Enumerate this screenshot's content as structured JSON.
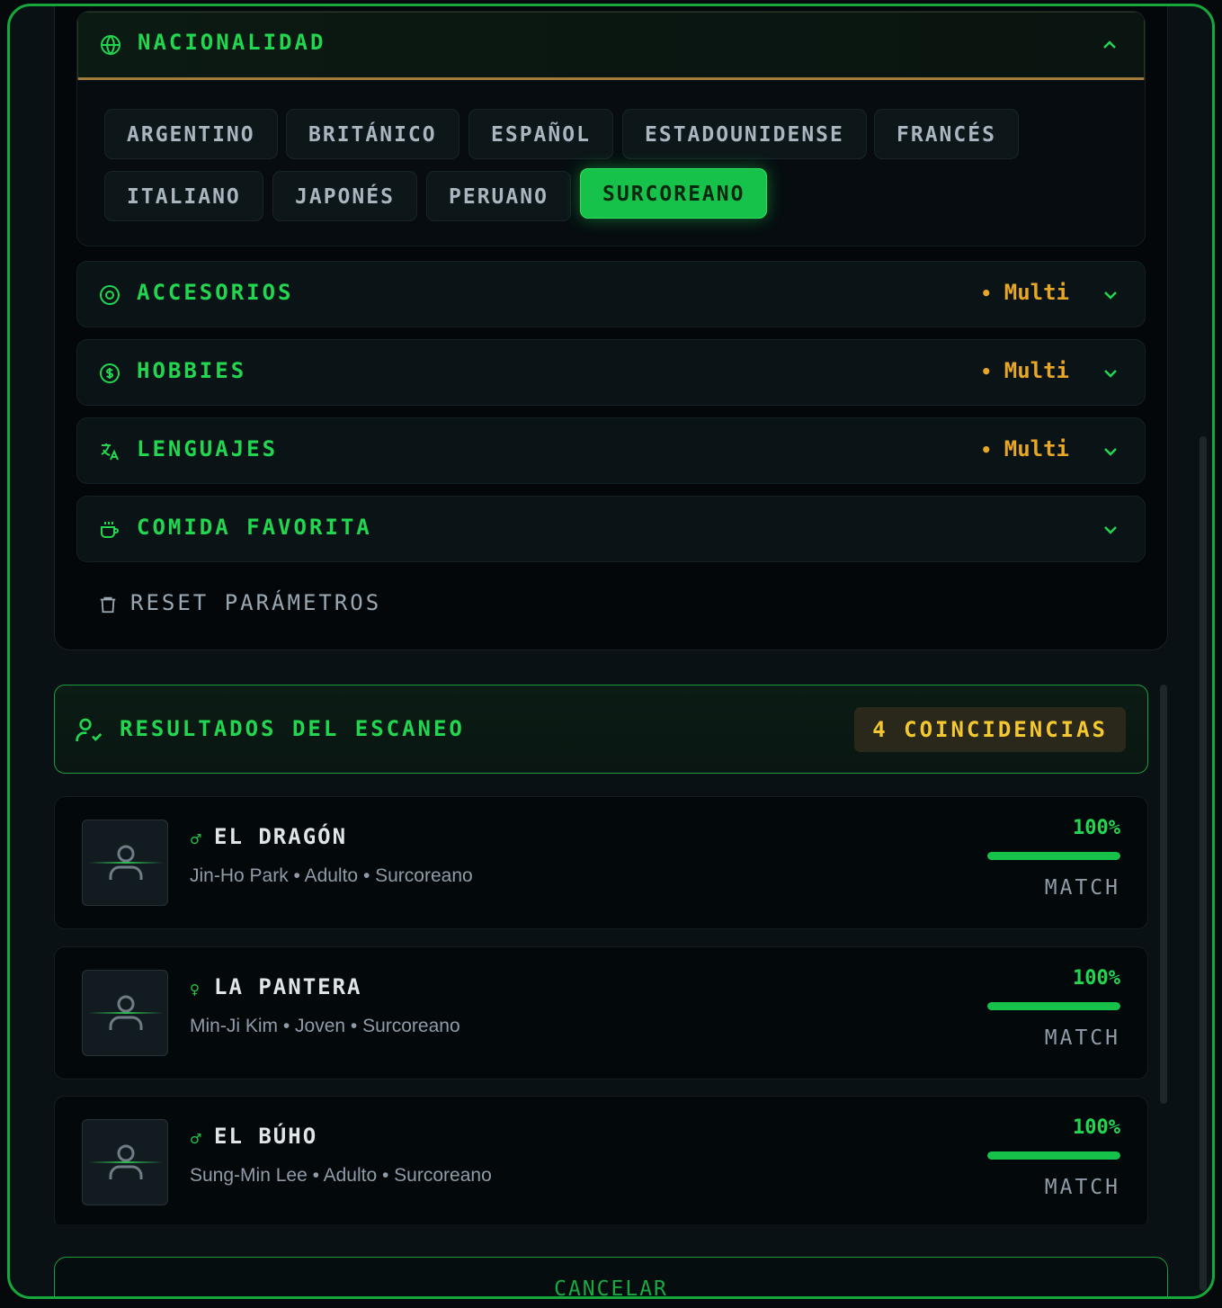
{
  "nationality": {
    "title": "NACIONALIDAD",
    "options": [
      "ARGENTINO",
      "BRITÁNICO",
      "ESPAÑOL",
      "ESTADOUNIDENSE",
      "FRANCÉS",
      "ITALIANO",
      "JAPONÉS",
      "PERUANO",
      "SURCOREANO"
    ],
    "selected": "SURCOREANO"
  },
  "sections": [
    {
      "title": "ACCESORIOS",
      "icon": "target-icon",
      "badge": "Multi"
    },
    {
      "title": "HOBBIES",
      "icon": "coin-icon",
      "badge": "Multi"
    },
    {
      "title": "LENGUAJES",
      "icon": "translate-icon",
      "badge": "Multi"
    },
    {
      "title": "COMIDA FAVORITA",
      "icon": "coffee-cup-icon",
      "badge": ""
    }
  ],
  "reset_label": "RESET PARÁMETROS",
  "results": {
    "title": "RESULTADOS DEL ESCANEO",
    "count_label": "4 COINCIDENCIAS",
    "items": [
      {
        "gender": "♂",
        "alias": "EL DRAGÓN",
        "meta": "Jin-Ho Park • Adulto • Surcoreano",
        "percent": "100%",
        "match_label": "MATCH",
        "fill": 1.0
      },
      {
        "gender": "♀",
        "alias": "LA PANTERA",
        "meta": "Min-Ji Kim • Joven • Surcoreano",
        "percent": "100%",
        "match_label": "MATCH",
        "fill": 1.0
      },
      {
        "gender": "♂",
        "alias": "EL BÚHO",
        "meta": "Sung-Min Lee • Adulto • Surcoreano",
        "percent": "100%",
        "match_label": "MATCH",
        "fill": 1.0
      }
    ]
  },
  "cancel_label": "CANCELAR",
  "colors": {
    "accent": "#22d650",
    "badge": "#e7a628",
    "count": "#f4c830"
  }
}
